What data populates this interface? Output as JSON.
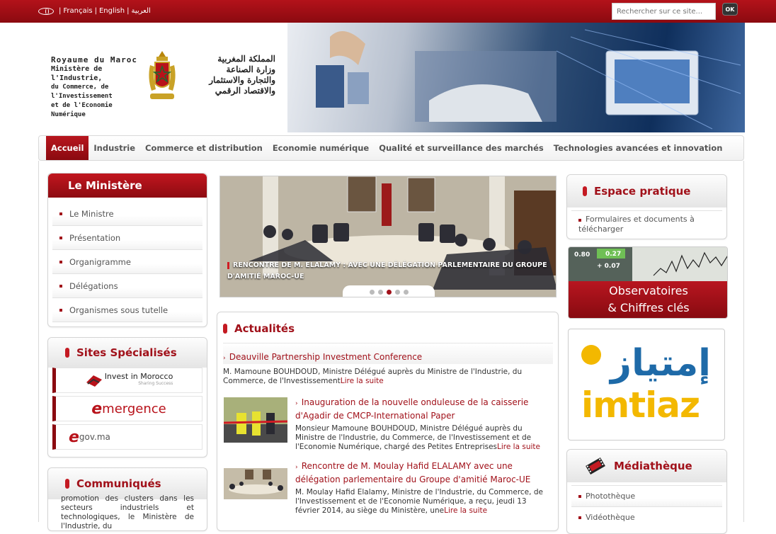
{
  "topbar": {
    "languages": [
      "Français",
      "English",
      "العربية"
    ],
    "search_placeholder": "Rechercher sur ce site...",
    "ok_label": "OK"
  },
  "header": {
    "fr_lines": [
      "Royaume du Maroc",
      "Ministère de l'Industrie,",
      "du Commerce, de l'Investissement",
      "et de l'Economie Numérique"
    ],
    "ar_lines": [
      "المملكة المغربية",
      "وزارة الصناعة",
      "والتجارة والاستثمار",
      "والاقتصاد الرقمي"
    ]
  },
  "nav": {
    "items": [
      "Accueil",
      "Industrie",
      "Commerce et distribution",
      "Economie numérique",
      "Qualité et surveillance des marchés",
      "Technologies avancées et innovation"
    ],
    "active": "Accueil"
  },
  "ministere": {
    "title": "Le Ministère",
    "items": [
      "Le Ministre",
      "Présentation",
      "Organigramme",
      "Délégations",
      "Organismes sous tutelle"
    ]
  },
  "sites": {
    "title": "Sites Spécialisés",
    "logos": [
      "Invest in Morocco",
      "Sharing Success",
      "mergence",
      "gov.ma"
    ]
  },
  "communiques": {
    "title": "Communiqués",
    "text": "promotion des clusters dans les secteurs industriels et technologiques, le Ministère de l'Industrie, du"
  },
  "slider": {
    "caption": "RENCONTRE DE M. ELALAMY  : AVEC UNE DÉLÉGATION PARLEMENTAIRE DU GROUPE D'AMITIÉ MAROC-UE",
    "pages": 5,
    "active_page": 3
  },
  "actualites": {
    "title": "Actualités",
    "items": [
      {
        "title": "Deauville Partnership Investment Conference",
        "body": "M. Mamoune BOUHDOUD, Ministre Délégué auprès du Ministre de l'Industrie, du Commerce, de l'Investissement",
        "more": "Lire la suite"
      },
      {
        "title": "Inauguration de la nouvelle onduleuse de la caisserie d'Agadir de CMCP-International Paper",
        "body": "Monsieur Mamoune BOUHDOUD, Ministre Délégué auprès du Ministre de l'Industrie, du Commerce, de l'Investissement et de l'Economie Numérique, chargé des Petites Entreprises",
        "more": "Lire la suite"
      },
      {
        "title": "Rencontre de M. Moulay Hafid ELALAMY avec une délégation parlementaire du Groupe d'amitié Maroc-UE",
        "body": "M. Moulay Hafid Elalamy, Ministre de l'Industrie, du Commerce, de l'Investissement et de l'Economie Numérique, a reçu, jeudi 13 février 2014, au siège du Ministère, une",
        "more": "Lire la suite"
      }
    ]
  },
  "espace": {
    "title": "Espace pratique",
    "items": [
      "Formulaires et documents à télécharger"
    ]
  },
  "observatoires": {
    "line1": "Observatoires",
    "line2": "& Chiffres clés",
    "ticks": [
      "0.80",
      "0.27",
      "+ 0.07"
    ]
  },
  "imtiaz": {
    "latin": "imtiaz",
    "arabic": "إمتياز"
  },
  "mediatheque": {
    "title": "Médiathèque",
    "items": [
      "Photothèque",
      "Vidéothèque"
    ]
  },
  "colors": {
    "brand_red": "#a1111a",
    "dark_red": "#8b0a10",
    "imtiaz_yellow": "#f3b800"
  }
}
